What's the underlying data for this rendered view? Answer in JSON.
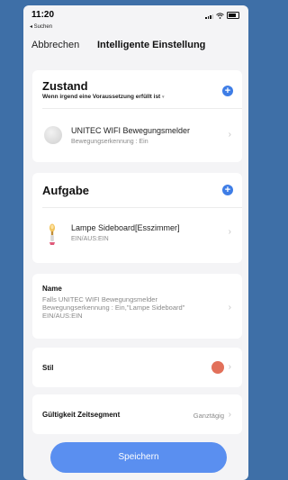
{
  "status_bar": {
    "time": "11:20",
    "back_app": "◂ Suchen"
  },
  "nav": {
    "cancel": "Abbrechen",
    "title": "Intelligente Einstellung"
  },
  "condition": {
    "title": "Zustand",
    "subtitle": "Wenn irgend eine Voraussetzung erfüllt ist",
    "item_title": "UNITEC WIFI Bewegungsmelder",
    "item_sub": "Bewegungserkennung : Ein"
  },
  "task": {
    "title": "Aufgabe",
    "item_title": "Lampe Sideboard[Esszimmer]",
    "item_sub": "EIN/AUS:EIN"
  },
  "name_row": {
    "label": "Name",
    "value": "Falls UNITEC WIFI Bewegungsmelder Bewegungserkennung : Ein,\"Lampe Sideboard\" EIN/AUS:EIN"
  },
  "style_row": {
    "label": "Stil",
    "color": "#e2705a"
  },
  "validity_row": {
    "label": "Gültigkeit Zeitsegment",
    "value": "Ganztägig"
  },
  "save_button": "Speichern",
  "colors": {
    "accent": "#3e7de6",
    "save": "#5a8ff0",
    "background": "#3e6fa7"
  }
}
